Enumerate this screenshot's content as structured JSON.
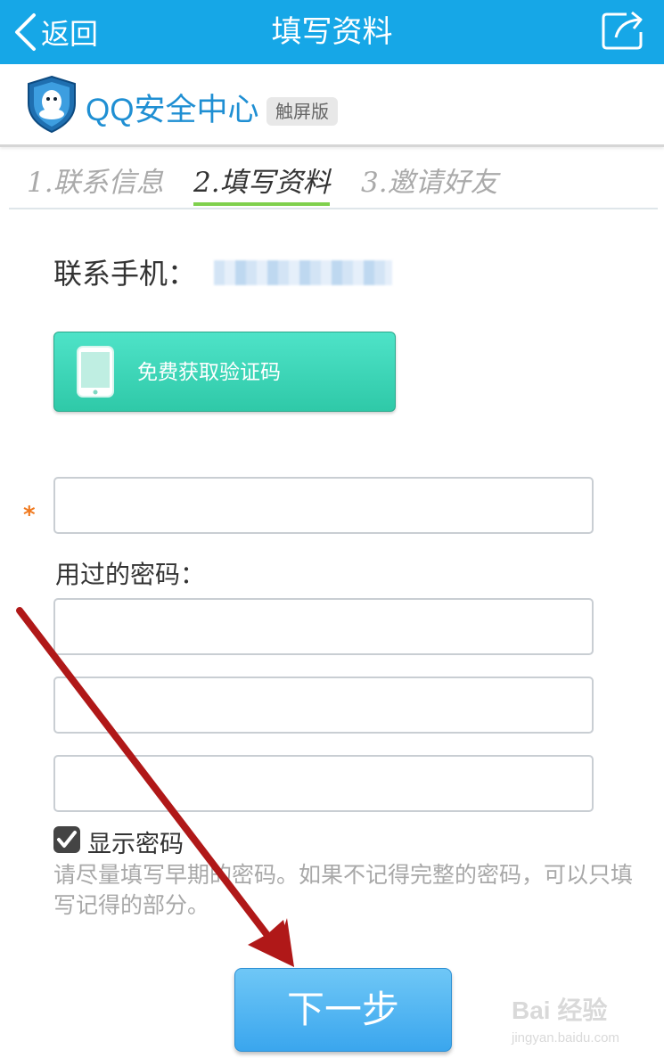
{
  "header": {
    "back_label": "返回",
    "title": "填写资料",
    "background_color": "#16a7e7"
  },
  "brand": {
    "name": "QQ安全中心",
    "badge": "触屏版"
  },
  "steps": [
    {
      "label": "1.联系信息",
      "active": false
    },
    {
      "label": "2.填写资料",
      "active": true
    },
    {
      "label": "3.邀请好友",
      "active": false
    }
  ],
  "form": {
    "phone_label": "联系手机：",
    "sms_button_label": "免费获取验证码",
    "required_mark": "*",
    "used_password_label": "用过的密码：",
    "show_password_label": "显示密码",
    "show_password_checked": true,
    "hint": "请尽量填写早期的密码。如果不记得完整的密码，可以只填写记得的部分。",
    "next_button_label": "下一步"
  },
  "watermark": {
    "text": "Bai 经验",
    "url": "jingyan.baidu.com"
  },
  "icons": [
    "chevron-left-icon",
    "share-icon",
    "qq-shield-icon",
    "phone-icon",
    "checkbox-checked-icon",
    "red-arrow-annotation"
  ]
}
